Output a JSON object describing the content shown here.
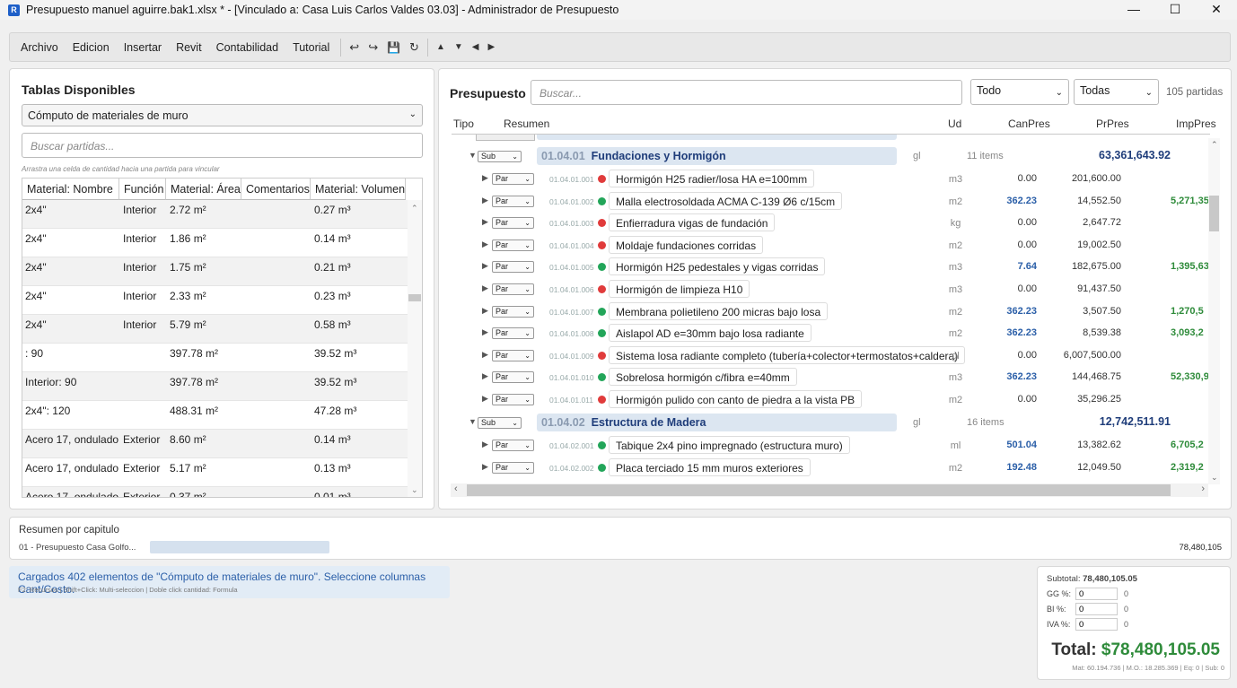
{
  "window": {
    "title": "Presupuesto manuel aguirre.bak1.xlsx * - [Vinculado a: Casa Luis Carlos Valdes 03.03] - Administrador de Presupuesto",
    "app_icon": "R"
  },
  "menu": [
    "Archivo",
    "Edicion",
    "Insertar",
    "Revit",
    "Contabilidad",
    "Tutorial"
  ],
  "toolbar": {
    "undo": "↩",
    "redo": "↪",
    "save": "💾",
    "refresh": "↻",
    "up": "▲",
    "down": "▼",
    "left": "◀",
    "right": "▶"
  },
  "left": {
    "title": "Tablas Disponibles",
    "table_select": "Cómputo de materiales de muro",
    "search_placeholder": "Buscar partidas...",
    "hint": "Arrastra una celda de cantidad hacia una partida para vincular",
    "columns": [
      "Material: Nombre",
      "Función",
      "Material: Área",
      "Comentarios",
      "Material: Volumen"
    ],
    "rows": [
      [
        "2x4\"",
        "Interior",
        "2.72 m²",
        "",
        "0.27 m³"
      ],
      [
        "2x4\"",
        "Interior",
        "1.86 m²",
        "",
        "0.14 m³"
      ],
      [
        "2x4\"",
        "Interior",
        "1.75 m²",
        "",
        "0.21 m³"
      ],
      [
        "2x4\"",
        "Interior",
        "2.33 m²",
        "",
        "0.23 m³"
      ],
      [
        "2x4\"",
        "Interior",
        "5.79 m²",
        "",
        "0.58 m³"
      ],
      [
        ": 90",
        "",
        "397.78 m²",
        "",
        "39.52 m³"
      ],
      [
        "Interior: 90",
        "",
        "397.78 m²",
        "",
        "39.52 m³"
      ],
      [
        "2x4\": 120",
        "",
        "488.31 m²",
        "",
        "47.28 m³"
      ],
      [
        "Acero 17, ondulado",
        "Exterior",
        "8.60 m²",
        "",
        "0.14 m³"
      ],
      [
        "Acero 17, ondulado",
        "Exterior",
        "5.17 m²",
        "",
        "0.13 m³"
      ],
      [
        "Acero 17, ondulado",
        "Exterior",
        "0.37 m²",
        "",
        "0.01 m³"
      ]
    ]
  },
  "right": {
    "title": "Presupuesto",
    "search_placeholder": "Buscar...",
    "filter1": "Todo",
    "filter2": "Todas",
    "count": "105 partidas",
    "columns": [
      "Tipo",
      "Resumen",
      "Ud",
      "CanPres",
      "PrPres",
      "ImpPres"
    ],
    "sub1": {
      "type": "Sub",
      "code": "01.04.01",
      "name": "Fundaciones y Hormigón",
      "ud": "gl",
      "items": "11 items",
      "total": "63,361,643.92"
    },
    "sub2": {
      "type": "Sub",
      "code": "01.04.02",
      "name": "Estructura de Madera",
      "ud": "gl",
      "items": "16 items",
      "total": "12,742,511.91"
    },
    "partidas": [
      {
        "type": "Par",
        "code": "01.04.01.001",
        "status": "#e03b3b",
        "desc": "Hormigón H25 radier/losa HA e=100mm",
        "ud": "m3",
        "can": "0.00",
        "pr": "201,600.00",
        "imp": ""
      },
      {
        "type": "Par",
        "code": "01.04.01.002",
        "status": "#22a559",
        "desc": "Malla electrosoldada ACMA C-139 Ø6 c/15cm",
        "ud": "m2",
        "can": "362.23",
        "pr": "14,552.50",
        "imp": "5,271,35"
      },
      {
        "type": "Par",
        "code": "01.04.01.003",
        "status": "#e03b3b",
        "desc": "Enfierradura vigas de fundación",
        "ud": "kg",
        "can": "0.00",
        "pr": "2,647.72",
        "imp": ""
      },
      {
        "type": "Par",
        "code": "01.04.01.004",
        "status": "#e03b3b",
        "desc": "Moldaje fundaciones corridas",
        "ud": "m2",
        "can": "0.00",
        "pr": "19,002.50",
        "imp": ""
      },
      {
        "type": "Par",
        "code": "01.04.01.005",
        "status": "#22a559",
        "desc": "Hormigón H25 pedestales y vigas corridas",
        "ud": "m3",
        "can": "7.64",
        "pr": "182,675.00",
        "imp": "1,395,63"
      },
      {
        "type": "Par",
        "code": "01.04.01.006",
        "status": "#e03b3b",
        "desc": "Hormigón de limpieza H10",
        "ud": "m3",
        "can": "0.00",
        "pr": "91,437.50",
        "imp": ""
      },
      {
        "type": "Par",
        "code": "01.04.01.007",
        "status": "#22a559",
        "desc": "Membrana polietileno 200 micras bajo losa",
        "ud": "m2",
        "can": "362.23",
        "pr": "3,507.50",
        "imp": "1,270,5"
      },
      {
        "type": "Par",
        "code": "01.04.01.008",
        "status": "#22a559",
        "desc": "Aislapol AD e=30mm bajo losa radiante",
        "ud": "m2",
        "can": "362.23",
        "pr": "8,539.38",
        "imp": "3,093,2"
      },
      {
        "type": "Par",
        "code": "01.04.01.009",
        "status": "#e03b3b",
        "desc": "Sistema losa radiante completo (tubería+colector+termostatos+caldera)",
        "ud": "gl",
        "can": "0.00",
        "pr": "6,007,500.00",
        "imp": ""
      },
      {
        "type": "Par",
        "code": "01.04.01.010",
        "status": "#22a559",
        "desc": "Sobrelosa hormigón c/fibra e=40mm",
        "ud": "m3",
        "can": "362.23",
        "pr": "144,468.75",
        "imp": "52,330,9"
      },
      {
        "type": "Par",
        "code": "01.04.01.011",
        "status": "#e03b3b",
        "desc": "Hormigón pulido con canto de piedra a la vista PB",
        "ud": "m2",
        "can": "0.00",
        "pr": "35,296.25",
        "imp": ""
      }
    ],
    "partidas2": [
      {
        "type": "Par",
        "code": "01.04.02.001",
        "status": "#22a559",
        "desc": "Tabique 2x4 pino impregnado (estructura muro)",
        "ud": "ml",
        "can": "501.04",
        "pr": "13,382.62",
        "imp": "6,705,2"
      },
      {
        "type": "Par",
        "code": "01.04.02.002",
        "status": "#22a559",
        "desc": "Placa terciado 15 mm muros exteriores",
        "ud": "m2",
        "can": "192.48",
        "pr": "12,049.50",
        "imp": "2,319,2"
      }
    ]
  },
  "summary": {
    "title": "Resumen por capitulo",
    "chapter": "01 - Presupuesto Casa Golfo...",
    "chapter_total": "78,480,105",
    "bar_fraction": 1.0
  },
  "status": {
    "message": "Cargados 402 elementos de \"Cómputo de materiales de muro\". Seleccione columnas Cant/Costo.",
    "shortcuts": "F2: Recursos | Shift+Click: Multi-seleccion | Doble click cantidad: Formula"
  },
  "totals": {
    "subtotal_label": "Subtotal:",
    "subtotal": "78,480,105.05",
    "gg_label": "GG %:",
    "gg": "0",
    "gg_val": "0",
    "bi_label": "BI %:",
    "bi": "0",
    "bi_val": "0",
    "iva_label": "IVA %:",
    "iva": "0",
    "iva_val": "0",
    "total_label": "Total:",
    "total": "$78,480,105.05",
    "breakdown": "Mat: 60.194.736 | M.O.: 18.285.369 | Eq: 0 | Sub: 0"
  }
}
